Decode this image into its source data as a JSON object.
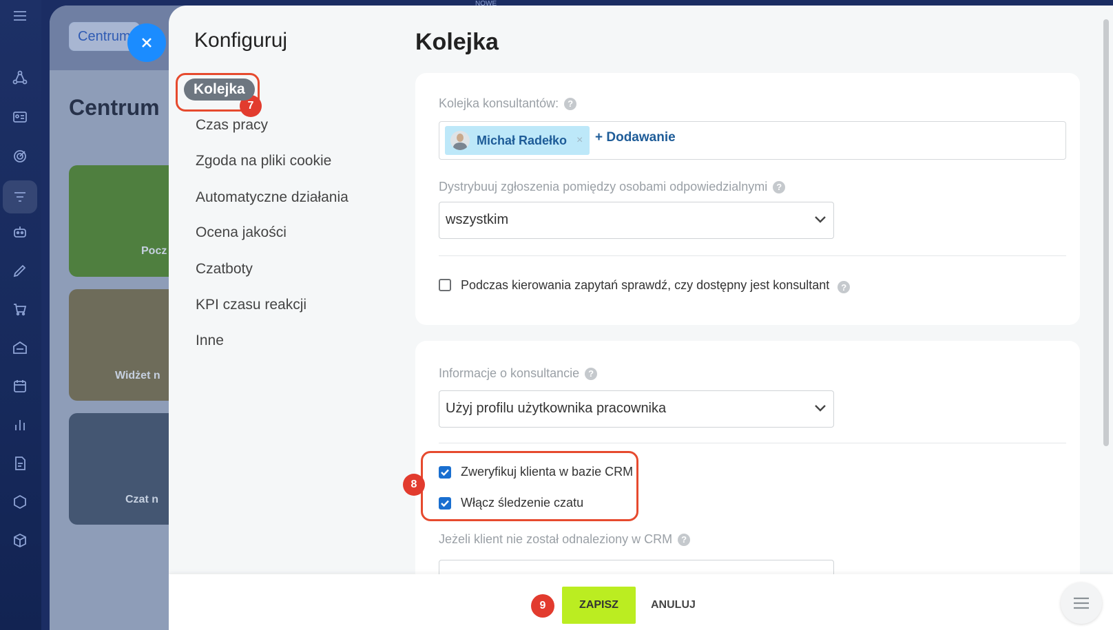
{
  "top_hint": "NOWE",
  "background": {
    "crumb": "Centrum",
    "title": "Centrum",
    "cards": [
      {
        "label": "Pocz",
        "color": "#4f7f3f"
      },
      {
        "label": "Widżet n",
        "color": "#6e6c5a"
      },
      {
        "label": "Czat n",
        "color": "#445672"
      }
    ]
  },
  "config": {
    "title": "Konfiguruj",
    "menu": [
      "Kolejka",
      "Czas pracy",
      "Zgoda na pliki cookie",
      "Automatyczne działania",
      "Ocena jakości",
      "Czatboty",
      "KPI czasu reakcji",
      "Inne"
    ]
  },
  "badges": {
    "b7": "7",
    "b8": "8",
    "b9": "9"
  },
  "main": {
    "title": "Kolejka",
    "queue": {
      "label": "Kolejka konsultantów:",
      "member": "Michał Radełko",
      "remove": "×",
      "add": "+ Dodawanie"
    },
    "distribute": {
      "label": "Dystrybuuj zgłoszenia pomiędzy osobami odpowiedzialnymi",
      "value": "wszystkim"
    },
    "check_available": {
      "label": "Podczas kierowania zapytań sprawdź, czy dostępny jest konsultant",
      "checked": false
    },
    "consultant_info": {
      "label": "Informacje o konsultancie",
      "value": "Użyj profilu użytkownika pracownika"
    },
    "verify_crm": {
      "label": "Zweryfikuj klienta w bazie CRM",
      "checked": true
    },
    "chat_tracking": {
      "label": "Włącz śledzenie czatu",
      "checked": true
    },
    "not_found": {
      "label": "Jeżeli klient nie został odnaleziony w CRM"
    }
  },
  "footer": {
    "save": "ZAPISZ",
    "cancel": "ANULUJ"
  },
  "colors": {
    "accent": "#1a6fd0",
    "save": "#bbed21",
    "highlight": "#e64a2e"
  }
}
